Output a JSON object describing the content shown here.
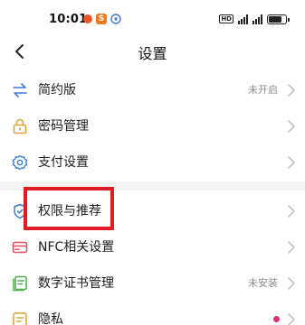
{
  "status_bar": {
    "time": "10:01",
    "app_badge": "S",
    "hd": "HD",
    "accent_orange": "#e9552c",
    "battery_level": 0.8
  },
  "nav": {
    "back_icon": "chevron-left-icon",
    "title": "设置"
  },
  "items": [
    {
      "label": "简约版",
      "value": "未开启",
      "icon": "swap-arrows-icon"
    },
    {
      "label": "密码管理",
      "value": "",
      "icon": "lock-icon"
    },
    {
      "label": "支付设置",
      "value": "",
      "icon": "gear-icon"
    },
    {
      "label": "权限与推荐",
      "value": "",
      "icon": "shield-icon"
    },
    {
      "label": "NFC相关设置",
      "value": "",
      "icon": "nfc-card-icon"
    },
    {
      "label": "数字证书管理",
      "value": "未安装",
      "icon": "certificate-icon"
    },
    {
      "label": "隐私",
      "value": "",
      "icon": "privacy-icon"
    }
  ],
  "colors": {
    "highlight": "#e21c23",
    "icon_blue": "#3a7bd5",
    "icon_orange": "#e2a23a",
    "icon_red": "#e0505a",
    "icon_green": "#4caf50",
    "notification_dot": "#e0307a"
  }
}
